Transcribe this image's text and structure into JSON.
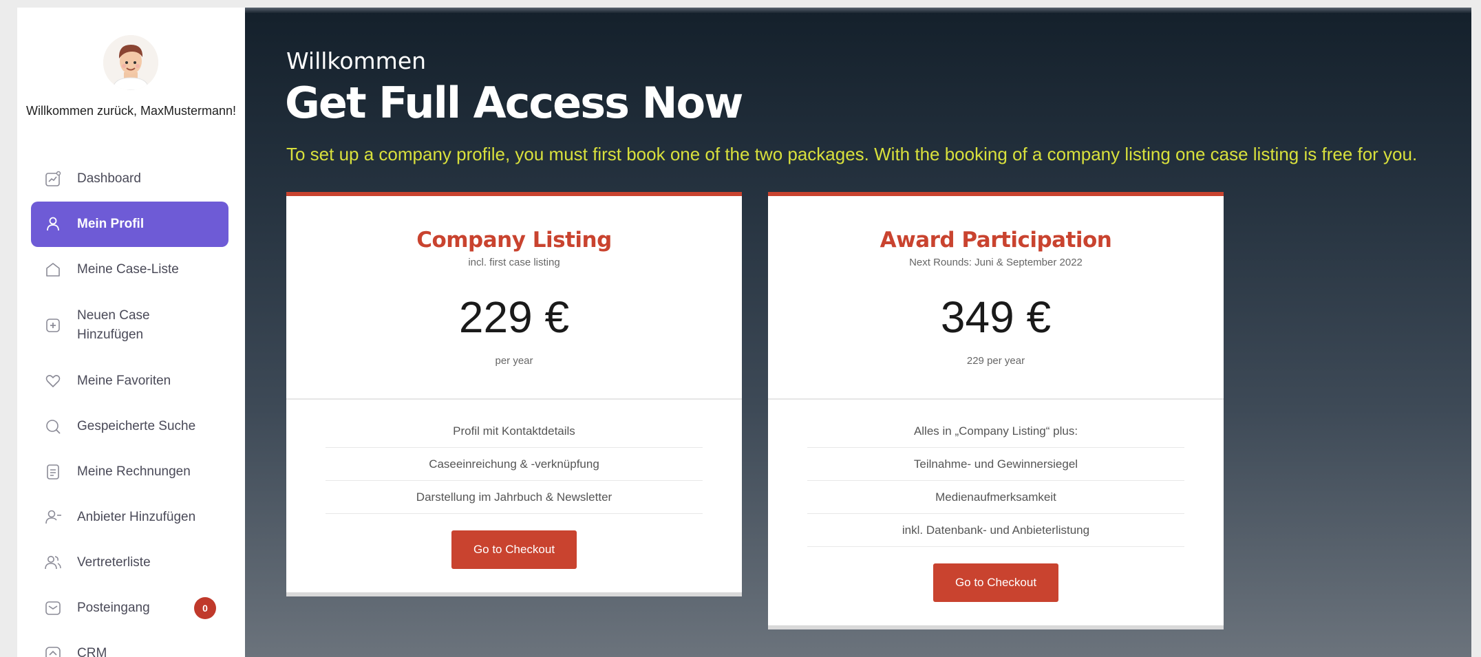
{
  "sidebar": {
    "welcome": "Willkommen zurück, MaxMustermann!",
    "items": [
      {
        "label": "Dashboard",
        "icon": "chart-line-icon"
      },
      {
        "label": "Mein Profil",
        "icon": "user-icon"
      },
      {
        "label": "Meine Case-Liste",
        "icon": "home-icon"
      },
      {
        "label": "Neuen Case Hinzufügen",
        "icon": "plus-square-icon"
      },
      {
        "label": "Meine Favoriten",
        "icon": "heart-icon"
      },
      {
        "label": "Gespeicherte Suche",
        "icon": "search-icon"
      },
      {
        "label": "Meine Rechnungen",
        "icon": "document-icon"
      },
      {
        "label": "Anbieter Hinzufügen",
        "icon": "user-add-icon"
      },
      {
        "label": "Vertreterliste",
        "icon": "users-icon"
      },
      {
        "label": "Posteingang",
        "icon": "inbox-icon",
        "badge": "0"
      },
      {
        "label": "CRM",
        "icon": "crm-icon"
      }
    ]
  },
  "main": {
    "eyebrow": "Willkommen",
    "headline": "Get Full Access Now",
    "intro": "To set up a company profile, you must first book one of the two packages. With the booking of a company listing one case listing is free for you."
  },
  "packages": [
    {
      "title": "Company Listing",
      "subtitle": "incl. first case listing",
      "price": "229 €",
      "period": "per year",
      "features": [
        "Profil mit Kontaktdetails",
        "Caseeinreichung & -verknüpfung",
        "Darstellung im Jahrbuch & Newsletter"
      ],
      "button": "Go to Checkout"
    },
    {
      "title": "Award Participation",
      "subtitle": "Next Rounds: Juni & September 2022",
      "price": "349 €",
      "period": "229 per year",
      "features": [
        "Alles in „Company Listing“ plus:",
        "Teilnahme- und Gewinnersiegel",
        "Medienaufmerksamkeit",
        "inkl. Datenbank- und Anbieterlistung"
      ],
      "button": "Go to Checkout"
    }
  ],
  "colors": {
    "accent": "#6e5bd6",
    "brand_red": "#c9432f",
    "intro_text": "#d8e03c"
  }
}
